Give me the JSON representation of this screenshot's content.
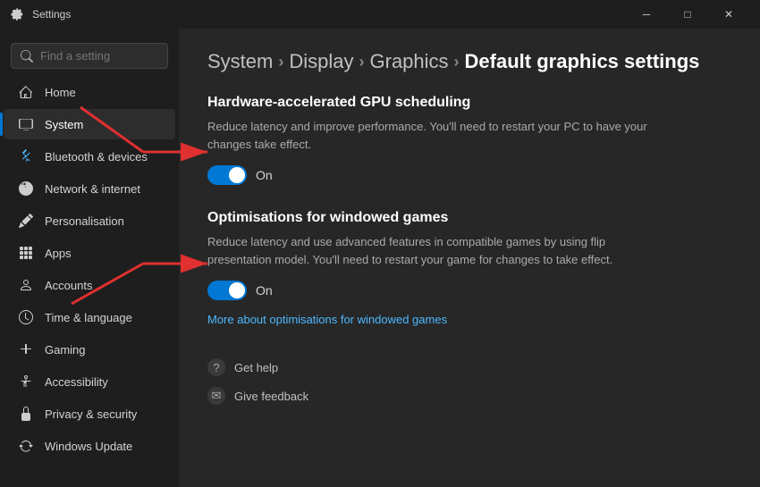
{
  "titlebar": {
    "title": "Settings",
    "min_label": "─",
    "max_label": "□",
    "close_label": "✕"
  },
  "sidebar": {
    "search_placeholder": "Find a setting",
    "items": [
      {
        "id": "home",
        "label": "Home",
        "icon": "⌂"
      },
      {
        "id": "system",
        "label": "System",
        "icon": "🖥",
        "active": true
      },
      {
        "id": "bluetooth",
        "label": "Bluetooth & devices",
        "icon": "⚡"
      },
      {
        "id": "network",
        "label": "Network & internet",
        "icon": "🌐"
      },
      {
        "id": "personalisation",
        "label": "Personalisation",
        "icon": "✏"
      },
      {
        "id": "apps",
        "label": "Apps",
        "icon": "📦"
      },
      {
        "id": "accounts",
        "label": "Accounts",
        "icon": "👤"
      },
      {
        "id": "time",
        "label": "Time & language",
        "icon": "🕐"
      },
      {
        "id": "gaming",
        "label": "Gaming",
        "icon": "🎮"
      },
      {
        "id": "accessibility",
        "label": "Accessibility",
        "icon": "♿"
      },
      {
        "id": "privacy",
        "label": "Privacy & security",
        "icon": "🔒"
      },
      {
        "id": "update",
        "label": "Windows Update",
        "icon": "🔄"
      }
    ]
  },
  "breadcrumb": {
    "segments": [
      {
        "label": "System",
        "active": false
      },
      {
        "label": "Display",
        "active": false
      },
      {
        "label": "Graphics",
        "active": false
      },
      {
        "label": "Default graphics settings",
        "active": true
      }
    ]
  },
  "sections": {
    "gpu_scheduling": {
      "title": "Hardware-accelerated GPU scheduling",
      "description": "Reduce latency and improve performance. You'll need to restart your PC to have your changes take effect.",
      "toggle_on": true,
      "toggle_label": "On"
    },
    "windowed_games": {
      "title": "Optimisations for windowed games",
      "description": "Reduce latency and use advanced features in compatible games by using flip presentation model. You'll need to restart your game for changes to take effect.",
      "toggle_on": true,
      "toggle_label": "On",
      "link_text": "More about optimisations for windowed games"
    }
  },
  "help": {
    "get_help": "Get help",
    "give_feedback": "Give feedback"
  }
}
